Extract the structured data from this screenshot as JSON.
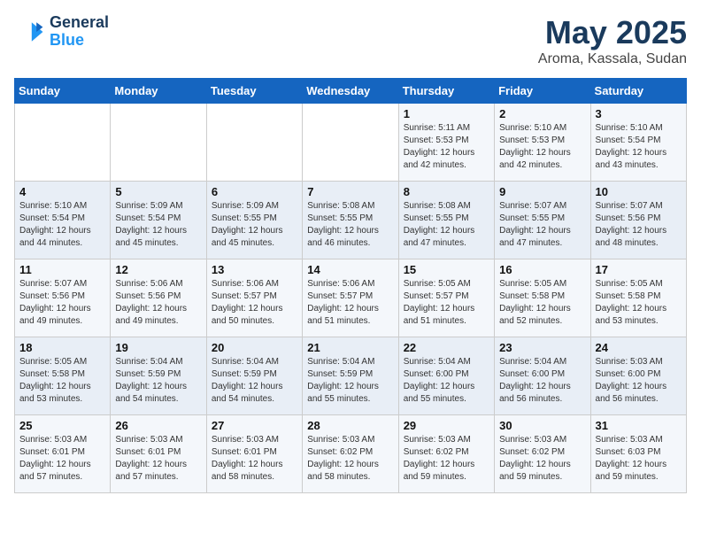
{
  "header": {
    "logo_line1": "General",
    "logo_line2": "Blue",
    "title": "May 2025",
    "subtitle": "Aroma, Kassala, Sudan"
  },
  "days_of_week": [
    "Sunday",
    "Monday",
    "Tuesday",
    "Wednesday",
    "Thursday",
    "Friday",
    "Saturday"
  ],
  "weeks": [
    [
      {
        "day": "",
        "info": ""
      },
      {
        "day": "",
        "info": ""
      },
      {
        "day": "",
        "info": ""
      },
      {
        "day": "",
        "info": ""
      },
      {
        "day": "1",
        "info": "Sunrise: 5:11 AM\nSunset: 5:53 PM\nDaylight: 12 hours\nand 42 minutes."
      },
      {
        "day": "2",
        "info": "Sunrise: 5:10 AM\nSunset: 5:53 PM\nDaylight: 12 hours\nand 42 minutes."
      },
      {
        "day": "3",
        "info": "Sunrise: 5:10 AM\nSunset: 5:54 PM\nDaylight: 12 hours\nand 43 minutes."
      }
    ],
    [
      {
        "day": "4",
        "info": "Sunrise: 5:10 AM\nSunset: 5:54 PM\nDaylight: 12 hours\nand 44 minutes."
      },
      {
        "day": "5",
        "info": "Sunrise: 5:09 AM\nSunset: 5:54 PM\nDaylight: 12 hours\nand 45 minutes."
      },
      {
        "day": "6",
        "info": "Sunrise: 5:09 AM\nSunset: 5:55 PM\nDaylight: 12 hours\nand 45 minutes."
      },
      {
        "day": "7",
        "info": "Sunrise: 5:08 AM\nSunset: 5:55 PM\nDaylight: 12 hours\nand 46 minutes."
      },
      {
        "day": "8",
        "info": "Sunrise: 5:08 AM\nSunset: 5:55 PM\nDaylight: 12 hours\nand 47 minutes."
      },
      {
        "day": "9",
        "info": "Sunrise: 5:07 AM\nSunset: 5:55 PM\nDaylight: 12 hours\nand 47 minutes."
      },
      {
        "day": "10",
        "info": "Sunrise: 5:07 AM\nSunset: 5:56 PM\nDaylight: 12 hours\nand 48 minutes."
      }
    ],
    [
      {
        "day": "11",
        "info": "Sunrise: 5:07 AM\nSunset: 5:56 PM\nDaylight: 12 hours\nand 49 minutes."
      },
      {
        "day": "12",
        "info": "Sunrise: 5:06 AM\nSunset: 5:56 PM\nDaylight: 12 hours\nand 49 minutes."
      },
      {
        "day": "13",
        "info": "Sunrise: 5:06 AM\nSunset: 5:57 PM\nDaylight: 12 hours\nand 50 minutes."
      },
      {
        "day": "14",
        "info": "Sunrise: 5:06 AM\nSunset: 5:57 PM\nDaylight: 12 hours\nand 51 minutes."
      },
      {
        "day": "15",
        "info": "Sunrise: 5:05 AM\nSunset: 5:57 PM\nDaylight: 12 hours\nand 51 minutes."
      },
      {
        "day": "16",
        "info": "Sunrise: 5:05 AM\nSunset: 5:58 PM\nDaylight: 12 hours\nand 52 minutes."
      },
      {
        "day": "17",
        "info": "Sunrise: 5:05 AM\nSunset: 5:58 PM\nDaylight: 12 hours\nand 53 minutes."
      }
    ],
    [
      {
        "day": "18",
        "info": "Sunrise: 5:05 AM\nSunset: 5:58 PM\nDaylight: 12 hours\nand 53 minutes."
      },
      {
        "day": "19",
        "info": "Sunrise: 5:04 AM\nSunset: 5:59 PM\nDaylight: 12 hours\nand 54 minutes."
      },
      {
        "day": "20",
        "info": "Sunrise: 5:04 AM\nSunset: 5:59 PM\nDaylight: 12 hours\nand 54 minutes."
      },
      {
        "day": "21",
        "info": "Sunrise: 5:04 AM\nSunset: 5:59 PM\nDaylight: 12 hours\nand 55 minutes."
      },
      {
        "day": "22",
        "info": "Sunrise: 5:04 AM\nSunset: 6:00 PM\nDaylight: 12 hours\nand 55 minutes."
      },
      {
        "day": "23",
        "info": "Sunrise: 5:04 AM\nSunset: 6:00 PM\nDaylight: 12 hours\nand 56 minutes."
      },
      {
        "day": "24",
        "info": "Sunrise: 5:03 AM\nSunset: 6:00 PM\nDaylight: 12 hours\nand 56 minutes."
      }
    ],
    [
      {
        "day": "25",
        "info": "Sunrise: 5:03 AM\nSunset: 6:01 PM\nDaylight: 12 hours\nand 57 minutes."
      },
      {
        "day": "26",
        "info": "Sunrise: 5:03 AM\nSunset: 6:01 PM\nDaylight: 12 hours\nand 57 minutes."
      },
      {
        "day": "27",
        "info": "Sunrise: 5:03 AM\nSunset: 6:01 PM\nDaylight: 12 hours\nand 58 minutes."
      },
      {
        "day": "28",
        "info": "Sunrise: 5:03 AM\nSunset: 6:02 PM\nDaylight: 12 hours\nand 58 minutes."
      },
      {
        "day": "29",
        "info": "Sunrise: 5:03 AM\nSunset: 6:02 PM\nDaylight: 12 hours\nand 59 minutes."
      },
      {
        "day": "30",
        "info": "Sunrise: 5:03 AM\nSunset: 6:02 PM\nDaylight: 12 hours\nand 59 minutes."
      },
      {
        "day": "31",
        "info": "Sunrise: 5:03 AM\nSunset: 6:03 PM\nDaylight: 12 hours\nand 59 minutes."
      }
    ]
  ]
}
